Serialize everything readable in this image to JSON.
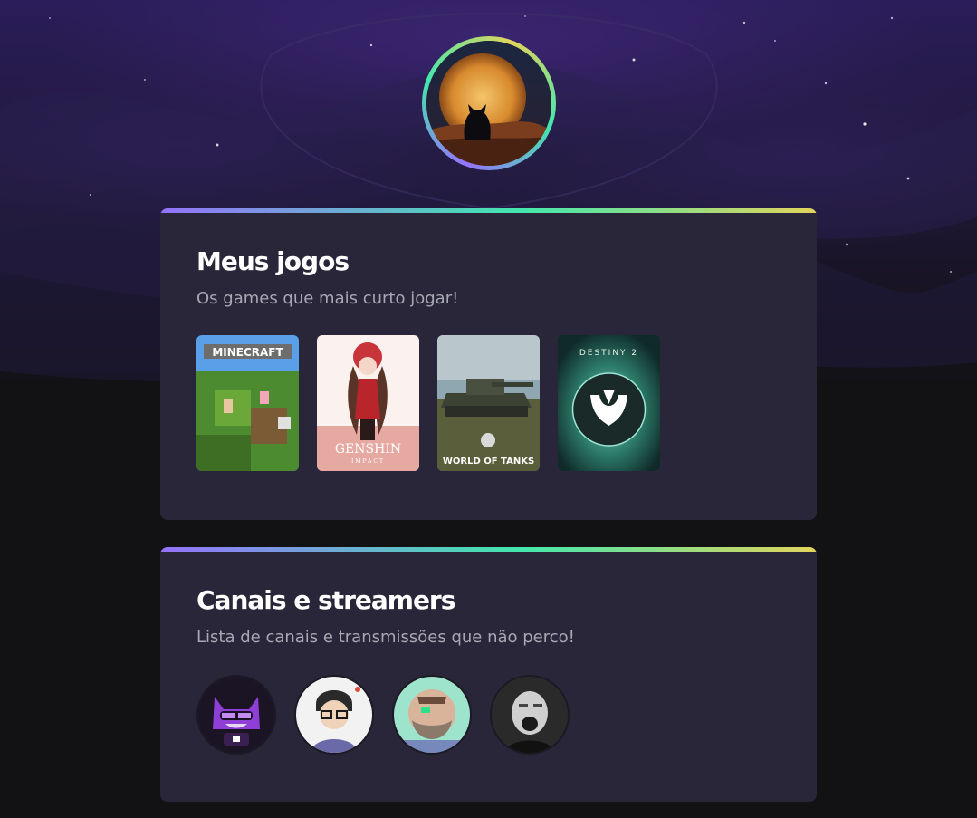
{
  "profile": {
    "avatar_icon": "cat-silhouette-moon-avatar"
  },
  "games_section": {
    "title": "Meus jogos",
    "subtitle": "Os games que mais curto jogar!",
    "games": [
      {
        "name": "MINECRAFT",
        "icon": "minecraft-cover"
      },
      {
        "name": "GENSHIN",
        "sub": "IMPACT",
        "icon": "genshin-impact-cover"
      },
      {
        "name": "WORLD OF TANKS",
        "icon": "world-of-tanks-cover"
      },
      {
        "name": "DESTINY 2",
        "icon": "destiny-2-cover"
      }
    ]
  },
  "streamers_section": {
    "title": "Canais e streamers",
    "subtitle": "Lista de canais e transmissões que não perco!",
    "streamers": [
      {
        "icon": "purple-cat-streamer-avatar"
      },
      {
        "icon": "glasses-boy-streamer-avatar"
      },
      {
        "icon": "bearded-viking-streamer-avatar"
      },
      {
        "icon": "shouting-man-streamer-avatar"
      }
    ]
  },
  "colors": {
    "card": "#29263a",
    "page": "#121214",
    "gradient": [
      "#9572fc",
      "#43e7ad",
      "#e2d45c"
    ]
  }
}
